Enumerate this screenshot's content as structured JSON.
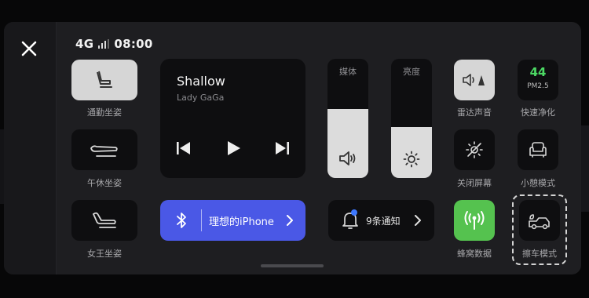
{
  "status": {
    "network": "4G",
    "time": "08:00"
  },
  "seat_controls": [
    {
      "label": "通勤坐姿",
      "icon": "seat-commute-icon"
    },
    {
      "label": "午休坐姿",
      "icon": "seat-nap-icon"
    },
    {
      "label": "女王坐姿",
      "icon": "seat-queen-icon"
    }
  ],
  "music": {
    "title": "Shallow",
    "artist": "Lady GaGa"
  },
  "sliders": {
    "media": {
      "label": "媒体",
      "level": 0.58
    },
    "brightness": {
      "label": "亮度",
      "level": 0.43
    }
  },
  "bluetooth": {
    "device": "理想的iPhone"
  },
  "notifications": {
    "text": "9条通知"
  },
  "quick_tiles": {
    "radar_sound": {
      "label": "雷达声音"
    },
    "fast_purify": {
      "label": "快速净化",
      "aqi": "44",
      "unit": "PM2.5",
      "aqi_color": "#4cd964"
    },
    "screen_off": {
      "label": "关闭屏幕"
    },
    "rest_mode": {
      "label": "小憩模式"
    },
    "cellular": {
      "label": "蜂窝数据",
      "color": "#55c24f"
    },
    "car_wash": {
      "label": "擦车模式"
    }
  }
}
